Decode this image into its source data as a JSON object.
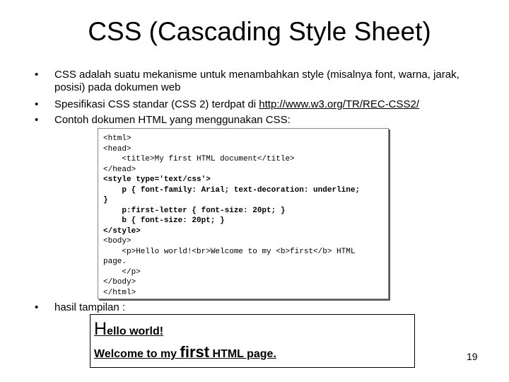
{
  "slide": {
    "title": "CSS (Cascading Style Sheet)",
    "bullets": [
      {
        "marker": "•",
        "text": "CSS adalah suatu mekanisme untuk menambahkan style (misalnya font, warna, jarak, posisi) pada dokumen web"
      },
      {
        "marker": "•",
        "text_before_link": "Spesifikasi CSS standar (CSS 2) terdpat di ",
        "link": "http://www.w3.org/TR/REC-CSS2/"
      },
      {
        "marker": "•",
        "text": "Contoh dokumen HTML yang menggunakan CSS:"
      },
      {
        "marker": "•",
        "text": "hasil tampilan :"
      }
    ],
    "code_lines": [
      "<html>",
      "<head>",
      "    <title>My first HTML document</title>",
      "</head>",
      "<style type='text/css'>",
      "    p { font-family: Arial; text-decoration: underline;",
      "}",
      "    p:first-letter { font-size: 20pt; }",
      "    b { font-size: 20pt; }",
      "</style>",
      "<body>",
      "    <p>Hello world!<br>Welcome to my <b>first</b> HTML",
      "page.",
      "    </p>",
      "</body>",
      "</html>"
    ],
    "result": {
      "line1_first_letter": "H",
      "line1_rest": "ello world!",
      "line2_before": "Welcome to my ",
      "line2_bold": "first",
      "line2_after": " HTML page."
    },
    "page_number": "19"
  }
}
